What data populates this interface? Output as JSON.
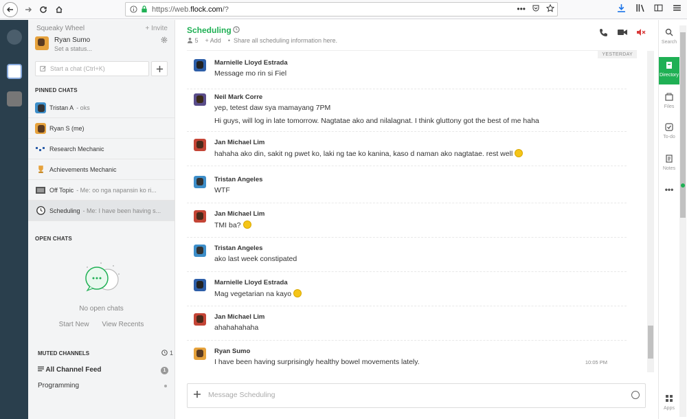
{
  "browser": {
    "url_prefix": "https://web.",
    "url_host": "flock.com",
    "url_suffix": "/?",
    "more_icon": "•••"
  },
  "sidebar": {
    "team_name": "Squeaky Wheel",
    "invite_label": "+ Invite",
    "user_name": "Ryan Sumo",
    "user_status": "Set a status...",
    "start_chat_placeholder": "Start a chat (Ctrl+K)",
    "pinned_label": "PINNED CHATS",
    "pinned": [
      {
        "name": "Tristan A",
        "preview": "- oks"
      },
      {
        "name": "Ryan S (me)",
        "preview": ""
      },
      {
        "name": "Research Mechanic",
        "preview": ""
      },
      {
        "name": "Achievements Mechanic",
        "preview": ""
      },
      {
        "name": "Off Topic",
        "preview": "- Me: oo nga napansin ko ri..."
      },
      {
        "name": "Scheduling",
        "preview": "- Me: I have been having s..."
      }
    ],
    "open_chats_label": "OPEN CHATS",
    "no_open_chats": "No open chats",
    "start_new": "Start New",
    "view_recents": "View Recents",
    "muted_label": "MUTED CHANNELS",
    "muted_count": "1",
    "muted": [
      {
        "name": "All Channel Feed",
        "badge": "1"
      },
      {
        "name": "Programming",
        "badge": ""
      }
    ]
  },
  "main": {
    "channel_title": "Scheduling",
    "member_count": "5",
    "add_label": "+ Add",
    "share_hint": "Share all scheduling information here.",
    "date_divider": "YESTERDAY",
    "messages": [
      {
        "author": "Marnielle Lloyd Estrada",
        "lines": [
          "Message mo rin si Fiel"
        ],
        "time": ""
      },
      {
        "author": "Neil Mark Corre",
        "lines": [
          "yep, tetest daw sya mamayang 7PM",
          "Hi guys, will log in late tomorrow. Nagtatae ako and nilalagnat. I think gluttony got the best of me haha"
        ],
        "time": ""
      },
      {
        "author": "Jan Michael Lim",
        "lines": [
          "hahaha ako din, sakit ng pwet ko, laki ng tae ko kanina, kaso d naman ako nagtatae. rest well"
        ],
        "time": ""
      },
      {
        "author": "Tristan Angeles",
        "lines": [
          "WTF"
        ],
        "time": ""
      },
      {
        "author": "Jan Michael Lim",
        "lines": [
          "TMI ba?"
        ],
        "time": ""
      },
      {
        "author": "Tristan Angeles",
        "lines": [
          "ako last week constipated"
        ],
        "time": ""
      },
      {
        "author": "Marnielle Lloyd Estrada",
        "lines": [
          "Mag vegetarian na kayo"
        ],
        "time": ""
      },
      {
        "author": "Jan Michael Lim",
        "lines": [
          "ahahahahaha"
        ],
        "time": ""
      },
      {
        "author": "Ryan Sumo",
        "lines": [
          "I have been having surprisingly healthy bowel movements lately."
        ],
        "time": "10:05 PM"
      }
    ],
    "composer_placeholder": "Message Scheduling"
  },
  "rightbar": {
    "items": [
      {
        "label": "Search"
      },
      {
        "label": "Directory"
      },
      {
        "label": "Files"
      },
      {
        "label": "To-do"
      },
      {
        "label": "Notes"
      },
      {
        "label": "Apps"
      }
    ]
  },
  "colors": {
    "accent": "#1fb054",
    "rail": "#2a3f4d",
    "mute_red": "#d93a3a"
  }
}
